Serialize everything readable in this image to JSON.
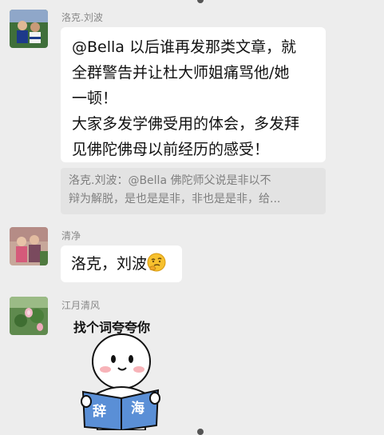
{
  "messages": [
    {
      "sender": "洛克.刘波",
      "lines": [
        "@Bella 以后谁再发那类文章，就",
        "全群警告并让杜大师姐痛骂他/她",
        "一顿！",
        "大家多发学佛受用的体会，多发拜",
        "见佛陀佛母以前经历的感受！"
      ]
    },
    {
      "quote_lines": [
        "洛克.刘波：@Bella  佛陀师父说是非以不",
        "辩为解脱，是也是是非，非也是是非，给..."
      ]
    },
    {
      "sender": "清净",
      "text": "洛克，刘波",
      "emoji": "thinking-face-emoji"
    },
    {
      "sender": "江月清风",
      "sticker": {
        "caption": "找个词夸夸你",
        "book_left": "辞",
        "book_right": "海"
      }
    }
  ]
}
